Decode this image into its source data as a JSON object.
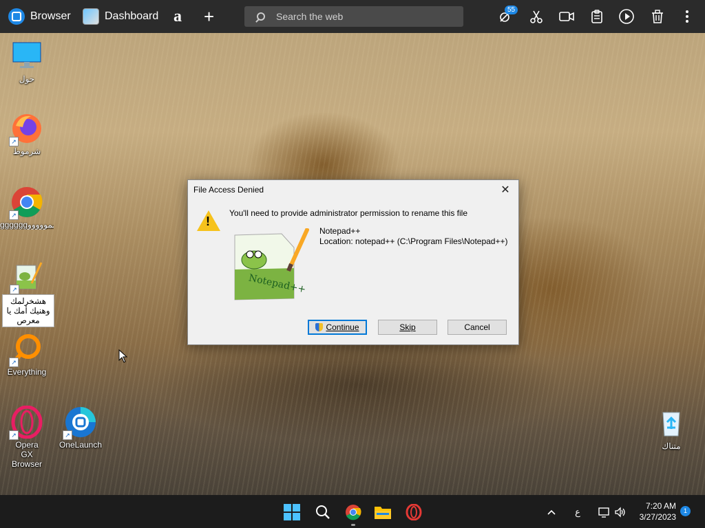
{
  "browser_bar": {
    "app_name": "Browser",
    "tab_label": "Dashboard",
    "amazon_glyph": "a",
    "new_tab_glyph": "+",
    "search_placeholder": "Search the web",
    "badge_count": "55",
    "tool_icons": [
      "bug-icon",
      "scissors-icon",
      "video-icon",
      "clipboard-icon",
      "play-icon",
      "trash-icon",
      "more-icon"
    ]
  },
  "desktop": {
    "icons": [
      {
        "label": "حول",
        "icon": "monitor-icon"
      },
      {
        "label": "شرموط",
        "icon": "firefox-icon"
      },
      {
        "label": "ggggggكسمووووو...",
        "icon": "chrome-icon"
      },
      {
        "label": "هشخرلمك وهنيك أمك يا معرص",
        "icon": "notepadpp-icon"
      },
      {
        "label": "Everything",
        "icon": "everything-icon"
      },
      {
        "label": "Opera GX Browser",
        "icon": "opera-gx-icon"
      },
      {
        "label": "OneLaunch",
        "icon": "onelaunch-icon"
      },
      {
        "label": "متناك",
        "icon": "recycle-bin-icon"
      }
    ]
  },
  "dialog": {
    "title": "File Access Denied",
    "message": "You'll need to provide administrator permission to rename this file",
    "file_name": "Notepad++",
    "location": "Location: notepad++ (C:\\Program Files\\Notepad++)",
    "buttons": {
      "continue": "Continue",
      "skip": "Skip",
      "cancel": "Cancel"
    },
    "logo_text": "Notepad++"
  },
  "taskbar": {
    "time": "7:20 AM",
    "date": "3/27/2023",
    "language": "ع",
    "notification_count": "1",
    "pinned": [
      "start-icon",
      "search-icon",
      "chrome-icon",
      "file-explorer-icon",
      "opera-icon"
    ]
  }
}
